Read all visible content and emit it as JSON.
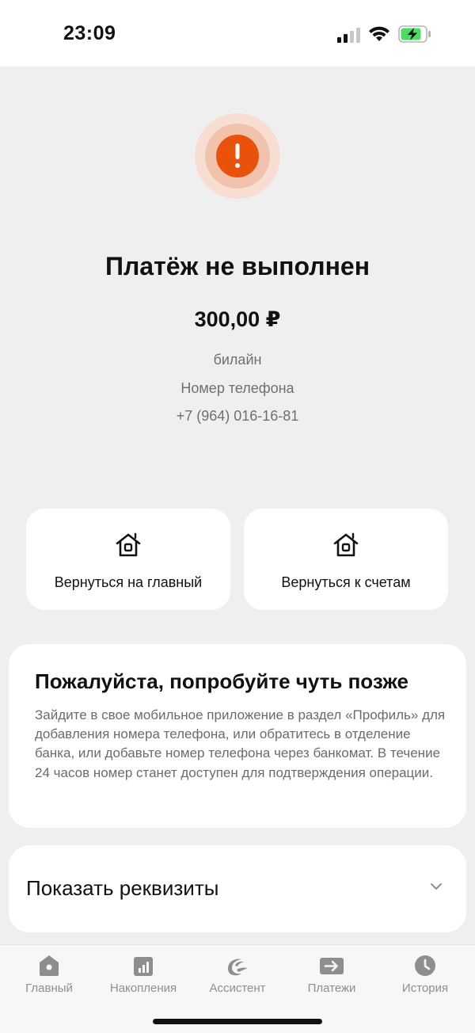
{
  "status_bar": {
    "time": "23:09"
  },
  "result": {
    "title": "Платёж не выполнен",
    "amount": "300,00 ₽",
    "operator": "билайн",
    "field_label": "Номер телефона",
    "phone": "+7 (964) 016-16-81",
    "alert_color": "#e8520a"
  },
  "actions": {
    "home_label": "Вернуться на главный",
    "accounts_label": "Вернуться к счетам"
  },
  "info": {
    "heading": "Пожалуйста, попробуйте чуть позже",
    "body": "Зайдите в свое мобильное приложение в раздел «Профиль» для добавления номера телефона, или обратитесь в отделение банка, или добавьте номер телефона через банкомат. В течение 24 часов номер станет доступен для подтверждения операции."
  },
  "requisites": {
    "label": "Показать реквизиты"
  },
  "tabbar": {
    "items": [
      {
        "label": "Главный",
        "icon": "home-icon"
      },
      {
        "label": "Накопления",
        "icon": "chart-icon"
      },
      {
        "label": "Ассистент",
        "icon": "assistant-icon"
      },
      {
        "label": "Платежи",
        "icon": "payments-arrow-icon"
      },
      {
        "label": "История",
        "icon": "clock-icon"
      }
    ]
  }
}
